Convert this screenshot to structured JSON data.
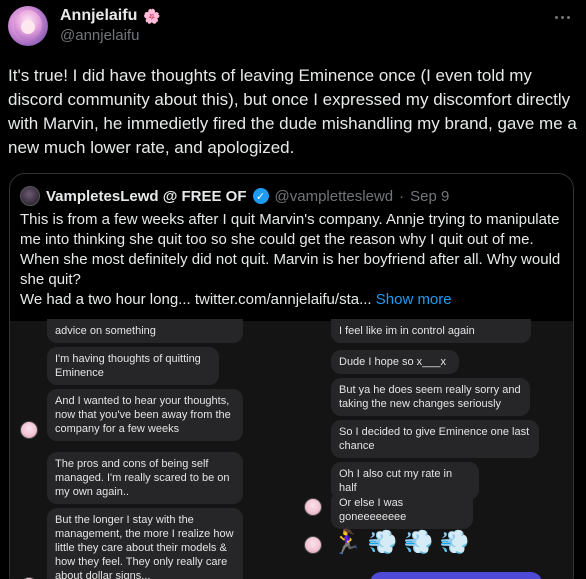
{
  "author": {
    "display_name": "Annjelaifu",
    "emoji": "🌸",
    "handle": "@annjelaifu"
  },
  "tweet_text": "It's true! I did have thoughts of leaving Eminence once (I even told my discord community about this), but once I expressed my discomfort directly with Marvin, he immedietly fired the dude mishandling my brand, gave me a new much lower rate, and apologized.",
  "quote": {
    "display_name": "VampletesLewd @ FREE OF",
    "handle": "@vampletteslewd",
    "separator": "·",
    "date": "Sep 9",
    "verified_mark": "✓",
    "text_line1": "This is from a few weeks after I quit Marvin's company. Annje trying to manipulate me into thinking she quit too so she could get the reason why I quit out of me. When she most definitely did not quit. Marvin is her boyfriend after all. Why would she quit?",
    "text_line2": "We had a two hour long...  twitter.com/annjelaifu/sta...",
    "show_more": "Show more"
  },
  "chat": {
    "left": [
      "advice on something",
      "I'm having thoughts of quitting Eminence",
      "And I wanted to hear your thoughts, now that you've been away from the company for a few weeks",
      "The pros and cons of being self managed. I'm really scared to be on my own again..",
      "But the longer I stay with the management, the more I realize how little they care about their models & how they feel. They only really care about dollar signs..."
    ],
    "right": [
      "I feel like im in control again",
      "Dude I hope so x___x",
      "But ya he does seem really sorry and taking the new changes seriously",
      "So I decided to give Eminence one last chance",
      "Oh I also cut my rate in half",
      "Or else I was goneeeeeeee"
    ],
    "emojis": [
      "🏃‍♀️",
      "💨",
      "💨",
      "💨"
    ]
  }
}
